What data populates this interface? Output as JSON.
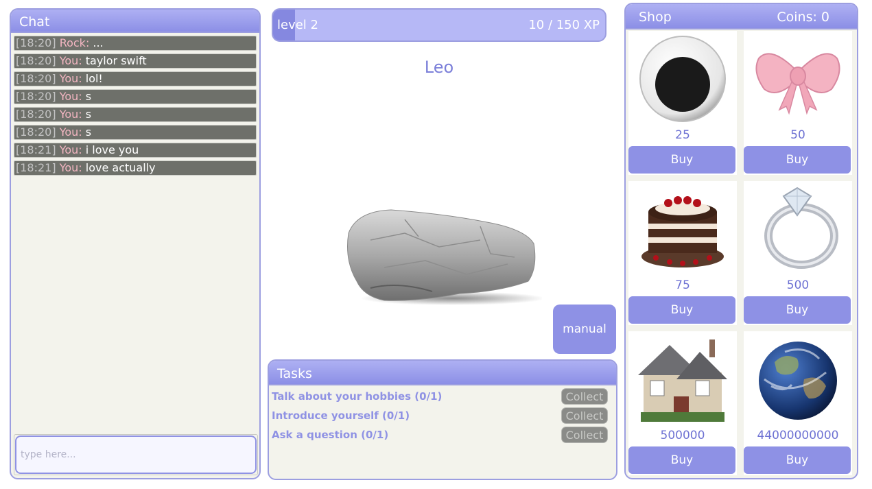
{
  "chat": {
    "title": "Chat",
    "messages": [
      {
        "time": "[18:20]",
        "sender": "Rock:",
        "text": "..."
      },
      {
        "time": "[18:20]",
        "sender": "You:",
        "text": "taylor swift"
      },
      {
        "time": "[18:20]",
        "sender": "You:",
        "text": "lol!"
      },
      {
        "time": "[18:20]",
        "sender": "You:",
        "text": "s"
      },
      {
        "time": "[18:20]",
        "sender": "You:",
        "text": "s"
      },
      {
        "time": "[18:20]",
        "sender": "You:",
        "text": "s"
      },
      {
        "time": "[18:21]",
        "sender": "You:",
        "text": "i love you"
      },
      {
        "time": "[18:21]",
        "sender": "You:",
        "text": "love actually"
      }
    ],
    "input_placeholder": "type here..."
  },
  "xp": {
    "level_label": "level 2",
    "count_label": "10 / 150 XP",
    "progress": 0.067
  },
  "character": {
    "name": "Leo"
  },
  "manual_label": "manual",
  "tasks": {
    "title": "Tasks",
    "items": [
      {
        "label": "Talk about your hobbies (0/1)",
        "button": "Collect"
      },
      {
        "label": "Introduce yourself (0/1)",
        "button": "Collect"
      },
      {
        "label": "Ask a question (0/1)",
        "button": "Collect"
      }
    ]
  },
  "shop": {
    "title": "Shop",
    "coins_label": "Coins: 0",
    "items": [
      {
        "icon": "googly-eye-icon",
        "price": "25",
        "button": "Buy"
      },
      {
        "icon": "pink-bow-icon",
        "price": "50",
        "button": "Buy"
      },
      {
        "icon": "cake-icon",
        "price": "75",
        "button": "Buy"
      },
      {
        "icon": "diamond-ring-icon",
        "price": "500",
        "button": "Buy"
      },
      {
        "icon": "house-icon",
        "price": "500000",
        "button": "Buy"
      },
      {
        "icon": "earth-icon",
        "price": "44000000000",
        "button": "Buy"
      }
    ]
  }
}
